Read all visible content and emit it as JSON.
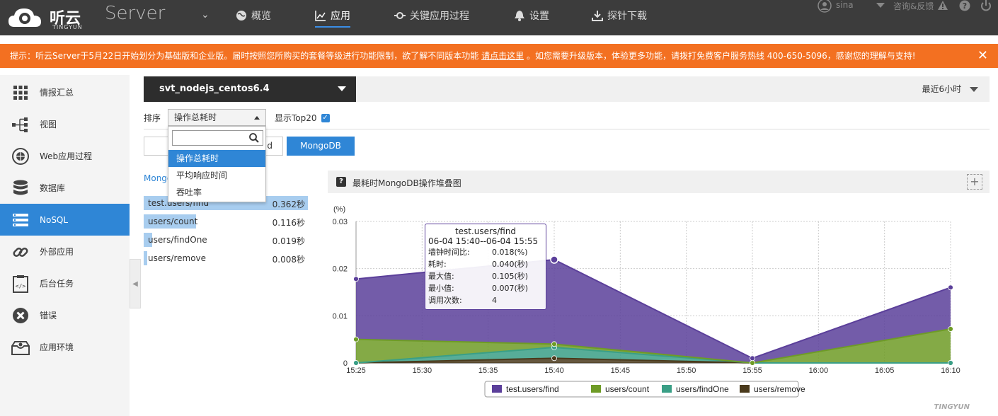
{
  "header": {
    "brand": "听云",
    "brand_sub": "TINGYUN",
    "product": "Server",
    "nav": [
      {
        "label": "概览",
        "icon": "globe-icon"
      },
      {
        "label": "应用",
        "icon": "chart-line-icon",
        "active": true
      },
      {
        "label": "关键应用过程",
        "icon": "key-process-icon"
      },
      {
        "label": "设置",
        "icon": "bell-icon"
      },
      {
        "label": "探针下载",
        "icon": "download-icon"
      }
    ],
    "user": "sina",
    "feedback": "咨询&反馈"
  },
  "notice": {
    "text_before": "提示：听云Server于5月22日开始划分为基础版和企业版。届时按照您所购买的套餐等级进行功能限制，欲了解不同版本功能",
    "link": "请点击这里",
    "text_after": "。如您需要升级版本，体验更多功能，请拨打免费客户服务热线 400-650-5096，感谢您的理解与支持!"
  },
  "sidebar": {
    "items": [
      {
        "label": "情报汇总",
        "icon": "grid-icon"
      },
      {
        "label": "视图",
        "icon": "topology-icon"
      },
      {
        "label": "Web应用过程",
        "icon": "web-process-icon"
      },
      {
        "label": "数据库",
        "icon": "database-icon"
      },
      {
        "label": "NoSQL",
        "icon": "nosql-icon",
        "active": true
      },
      {
        "label": "外部应用",
        "icon": "link-icon"
      },
      {
        "label": "后台任务",
        "icon": "task-icon"
      },
      {
        "label": "错误",
        "icon": "error-icon"
      },
      {
        "label": "应用环境",
        "icon": "environment-icon"
      }
    ]
  },
  "app_selector": {
    "name": "svt_nodejs_centos6.4"
  },
  "time_range": "最近6小时",
  "controls": {
    "sort_label": "排序",
    "sort_value": "操作总耗时",
    "top20_label": "显示Top20",
    "top20_checked": true,
    "dropdown_options": [
      "操作总耗时",
      "平均响应时间",
      "吞吐率"
    ],
    "btn_left_partial": "d",
    "btn_mongodb": "MongoDB"
  },
  "list": {
    "heading": "Mongo",
    "rows": [
      {
        "name": "test.users/find",
        "value": "0.362秒",
        "fraction": 1.0
      },
      {
        "name": "users/count",
        "value": "0.116秒",
        "fraction": 0.32
      },
      {
        "name": "users/findOne",
        "value": "0.019秒",
        "fraction": 0.05
      },
      {
        "name": "users/remove",
        "value": "0.008秒",
        "fraction": 0.02
      }
    ]
  },
  "chart_header": {
    "title": "最耗时MongoDB操作堆叠图",
    "help": "?",
    "expand": "+"
  },
  "tooltip": {
    "title": "test.users/find",
    "range": "06-04 15:40--06-04 15:55",
    "rows": [
      {
        "k": "墙钟时间比:",
        "v": "0.018(%)"
      },
      {
        "k": "耗时:",
        "v": "0.040(秒)"
      },
      {
        "k": "最大值:",
        "v": "0.105(秒)"
      },
      {
        "k": "最小值:",
        "v": "0.007(秒)"
      },
      {
        "k": "调用次数:",
        "v": "4"
      }
    ]
  },
  "chart_data": {
    "type": "area",
    "stacked": true,
    "ylabel": "(%)",
    "ylim": [
      0,
      0.03
    ],
    "yticks": [
      "0",
      "0.01",
      "0.02",
      "0.03"
    ],
    "xtick_labels": [
      "15:25",
      "15:30",
      "15:35",
      "15:40",
      "15:45",
      "15:50",
      "15:55",
      "16:00",
      "16:05",
      "16:10"
    ],
    "x": [
      "15:25",
      "15:40",
      "15:55",
      "16:10"
    ],
    "series": [
      {
        "name": "test.users/find",
        "color": "#5b3f9a",
        "values": [
          0.0128,
          0.0179,
          0.001,
          0.0088
        ]
      },
      {
        "name": "users/count",
        "color": "#6e9b26",
        "values": [
          0.005,
          0.0007,
          0.0,
          0.0072
        ]
      },
      {
        "name": "users/findOne",
        "color": "#3a9f86",
        "values": [
          0.0,
          0.0023,
          0.0,
          0.0
        ]
      },
      {
        "name": "users/remove",
        "color": "#4a3a1c",
        "values": [
          0.0,
          0.001,
          0.0,
          0.0
        ]
      }
    ],
    "grid": true,
    "legend": "bottom"
  },
  "watermark": "TINGYUN"
}
